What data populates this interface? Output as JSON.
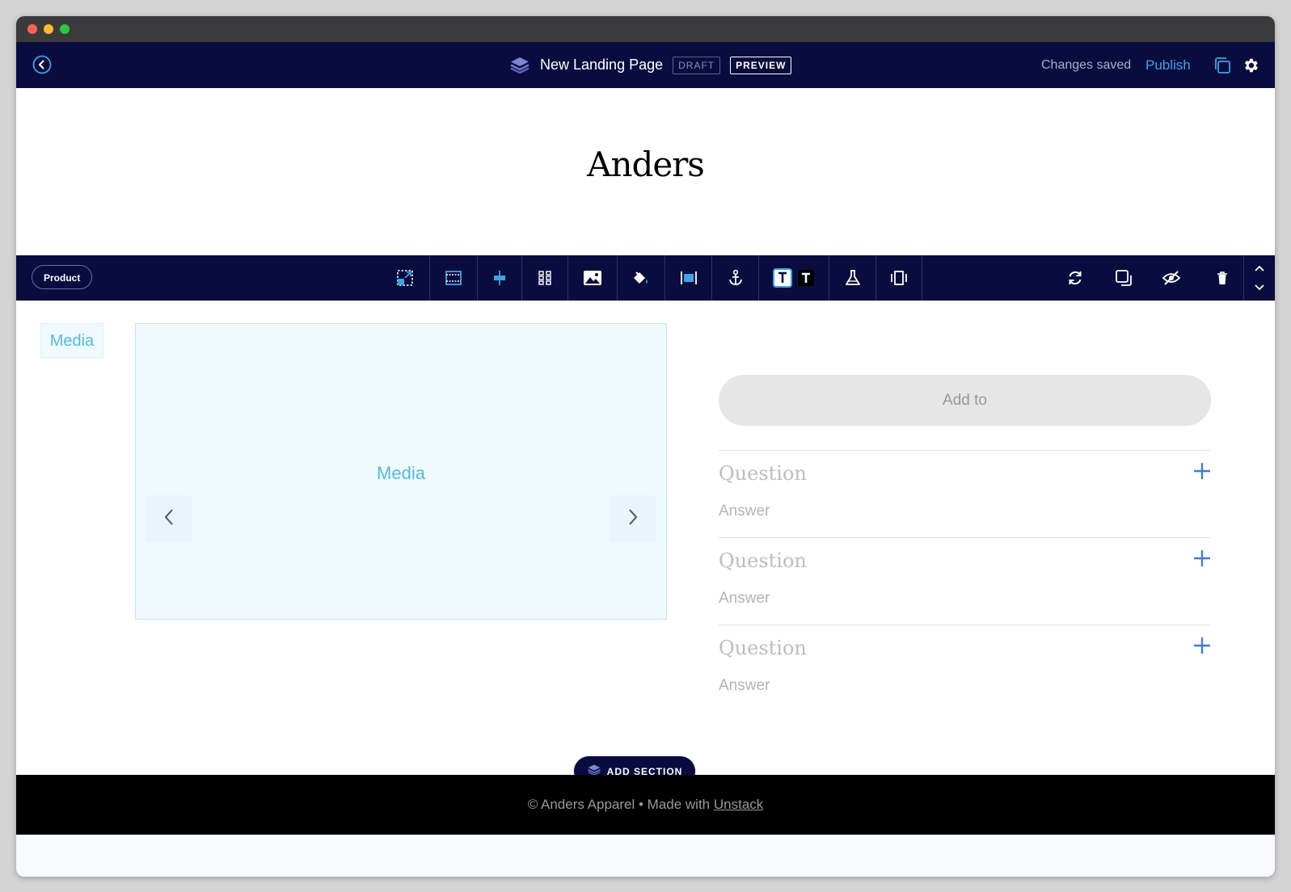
{
  "header": {
    "title": "New Landing Page",
    "draft_badge": "DRAFT",
    "preview_button": "PREVIEW",
    "status": "Changes saved",
    "publish": "Publish"
  },
  "site": {
    "logo": "Anders"
  },
  "section_toolbar": {
    "section_label": "Product",
    "tools": [
      "select-area-icon",
      "full-width-icon",
      "align-center-icon",
      "columns-icon",
      "image-icon",
      "paint-bucket-icon",
      "stretch-icon",
      "anchor-icon",
      "text-light-icon",
      "text-dark-icon",
      "flask-icon",
      "carousel-icon"
    ],
    "actions": [
      "refresh-icon",
      "duplicate-icon",
      "hide-icon",
      "trash-icon",
      "reorder-arrows-icon"
    ]
  },
  "product": {
    "media_tag": "Media",
    "media_placeholder": "Media",
    "add_button": "Add to",
    "faqs": [
      {
        "question": "Question",
        "answer": "Answer"
      },
      {
        "question": "Question",
        "answer": "Answer"
      },
      {
        "question": "Question",
        "answer": "Answer"
      }
    ]
  },
  "add_section": "ADD SECTION",
  "footer": {
    "text": "© Anders Apparel • Made with ",
    "link": "Unstack"
  },
  "colors": {
    "navy": "#0a0c3f",
    "accent": "#3ea4e6",
    "media_blue": "#56b8e0"
  }
}
